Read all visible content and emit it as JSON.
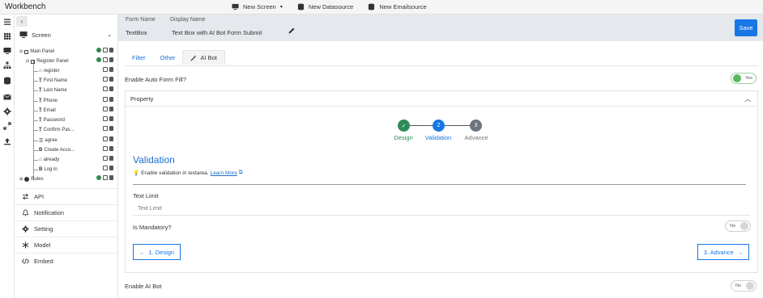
{
  "app": {
    "title": "Workbench"
  },
  "topbar": {
    "new_screen": "New Screen",
    "new_datasource": "New Datasource",
    "new_emailsource": "New Emailsource"
  },
  "rail_icons": [
    "menu-icon",
    "grid-icon",
    "monitor-icon",
    "sitemap-icon",
    "database-icon",
    "mail-icon",
    "gear-icon",
    "compress-icon",
    "upload-icon"
  ],
  "tree": {
    "screen_label": "Screen",
    "nodes": [
      {
        "label": "Main Panel"
      },
      {
        "label": "Register Panel"
      },
      {
        "label": "register"
      },
      {
        "label": "First Name"
      },
      {
        "label": "Last Name"
      },
      {
        "label": "Phone"
      },
      {
        "label": "Email"
      },
      {
        "label": "Password"
      },
      {
        "label": "Confirm Pas..."
      },
      {
        "label": "agree"
      },
      {
        "label": "Create Acco..."
      },
      {
        "label": "already"
      },
      {
        "label": "Log in"
      },
      {
        "label": "Rules"
      }
    ],
    "nav": [
      {
        "label": "API",
        "icon": "swap-arrows-icon"
      },
      {
        "label": "Notification",
        "icon": "bell-icon"
      },
      {
        "label": "Setting",
        "icon": "gear-icon"
      },
      {
        "label": "Model",
        "icon": "snowflake-icon"
      },
      {
        "label": "Embed",
        "icon": "code-icon"
      }
    ]
  },
  "header": {
    "form_name_label": "Form Name",
    "form_name_value": "TextBox",
    "display_name_label": "Display Name",
    "display_name_value": "Text Box with AI Bot Form Submit",
    "save_label": "Save"
  },
  "tabs": [
    {
      "label": "Filter"
    },
    {
      "label": "Other"
    },
    {
      "label": "AI Bot"
    }
  ],
  "auto_fill": {
    "label": "Enable Auto Form Fill?",
    "toggle": "Yes"
  },
  "property": {
    "title": "Property",
    "steps": [
      {
        "num": "✓",
        "label": "Design",
        "color": "#2e8b57"
      },
      {
        "num": "2",
        "label": "Validation",
        "color": "#1677e5"
      },
      {
        "num": "3",
        "label": "Advance",
        "color": "#6c757d"
      }
    ],
    "section_title": "Validation",
    "hint": "Enable validation in textarea.",
    "learn_more": "Learn More",
    "text_limit_label": "Text Limit",
    "text_limit_placeholder": "Text Limit",
    "mandatory_label": "Is Mandatory?",
    "mandatory_toggle": "No",
    "prev_btn": "1. Design",
    "next_btn": "3. Advance"
  },
  "ai_bot": {
    "label": "Enable AI Bot",
    "toggle": "No"
  }
}
